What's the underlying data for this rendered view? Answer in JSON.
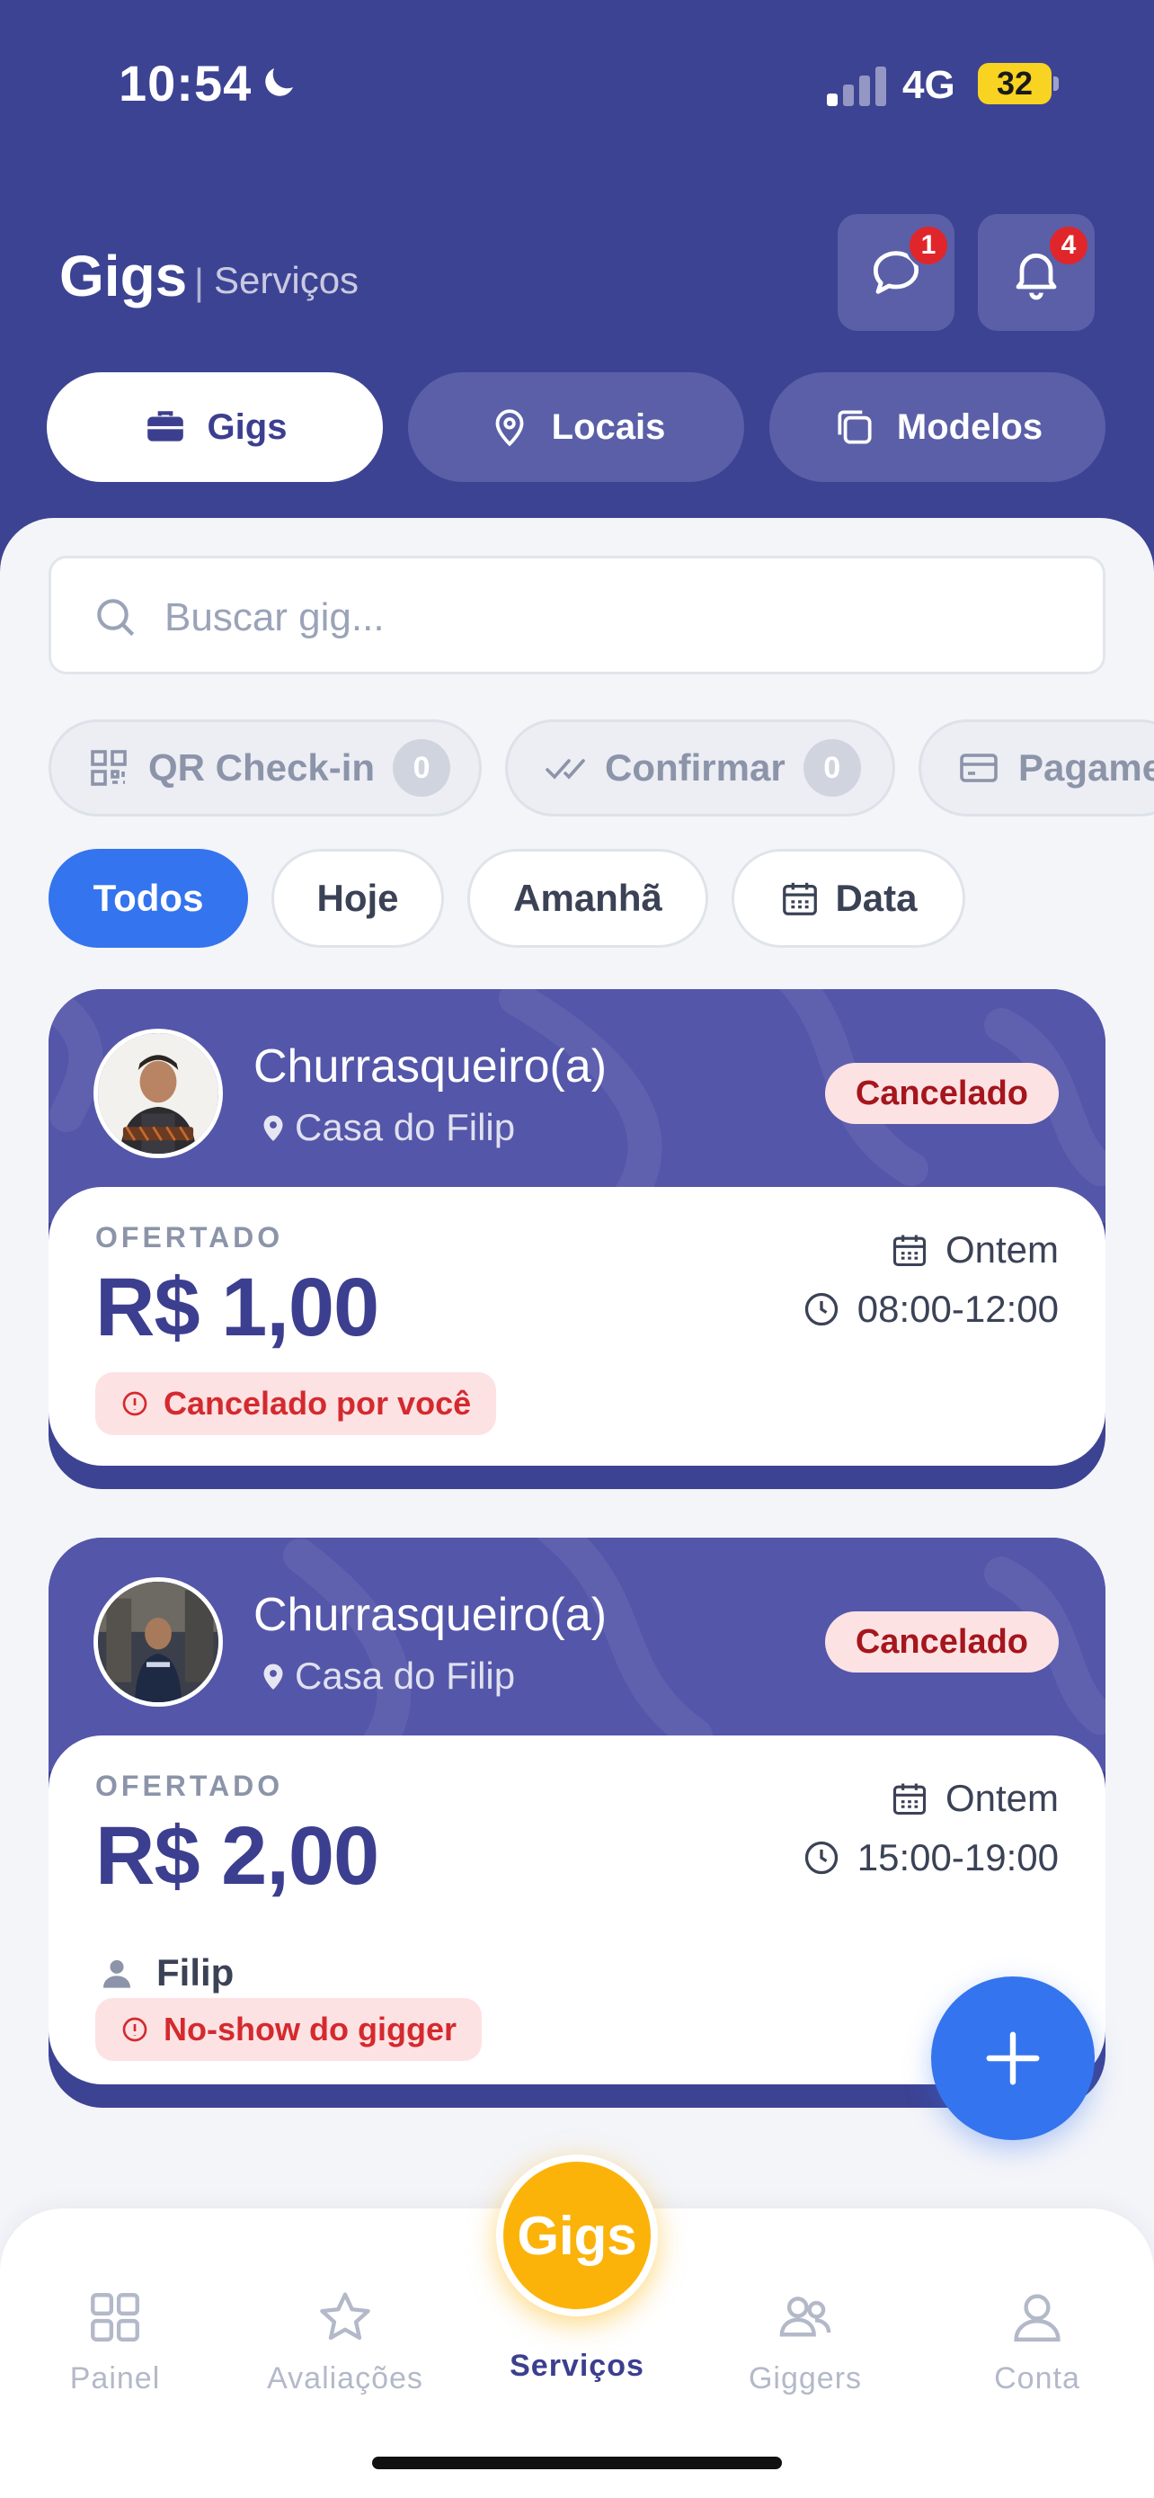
{
  "status_bar": {
    "time": "10:54",
    "network": "4G",
    "battery": "32"
  },
  "header": {
    "title": "Gigs",
    "separator": "|",
    "subtitle": "Serviços",
    "chat_badge": "1",
    "notifications_badge": "4"
  },
  "tabs": [
    {
      "label": "Gigs",
      "icon": "briefcase-icon",
      "active": true
    },
    {
      "label": "Locais",
      "icon": "map-pin-icon",
      "active": false
    },
    {
      "label": "Modelos",
      "icon": "copy-icon",
      "active": false
    }
  ],
  "search": {
    "placeholder": "Buscar gig..."
  },
  "quick_filters": [
    {
      "label": "QR Check-in",
      "count": "0"
    },
    {
      "label": "Confirmar",
      "count": "0"
    },
    {
      "label": "Pagamentos"
    }
  ],
  "date_filters": [
    {
      "label": "Todos",
      "active": true
    },
    {
      "label": "Hoje"
    },
    {
      "label": "Amanhã"
    },
    {
      "label": "Data"
    }
  ],
  "gigs": [
    {
      "role": "Churrasqueiro(a)",
      "location": "Casa do Filip",
      "status": "Cancelado",
      "offer_label": "OFERTADO",
      "price": "R$ 1,00",
      "date": "Ontem",
      "time": "08:00-12:00",
      "note": "Cancelado por você"
    },
    {
      "role": "Churrasqueiro(a)",
      "location": "Casa do Filip",
      "status": "Cancelado",
      "offer_label": "OFERTADO",
      "price": "R$ 2,00",
      "date": "Ontem",
      "time": "15:00-19:00",
      "person": "Filip",
      "note": "No-show do gigger"
    }
  ],
  "bottom_nav": {
    "center_badge": "Gigs",
    "items": [
      {
        "label": "Painel",
        "icon": "grid-icon"
      },
      {
        "label": "Avaliações",
        "icon": "star-icon"
      },
      {
        "label": "Serviços",
        "active": true
      },
      {
        "label": "Giggers",
        "icon": "users-icon"
      },
      {
        "label": "Conta",
        "icon": "user-icon"
      }
    ]
  },
  "colors": {
    "header_bg": "#3d4393",
    "primary_blue": "#3474ee",
    "cancel_bg": "#fde2e4",
    "cancel_text": "#a5161c",
    "accent_yellow": "#fbb30a"
  }
}
